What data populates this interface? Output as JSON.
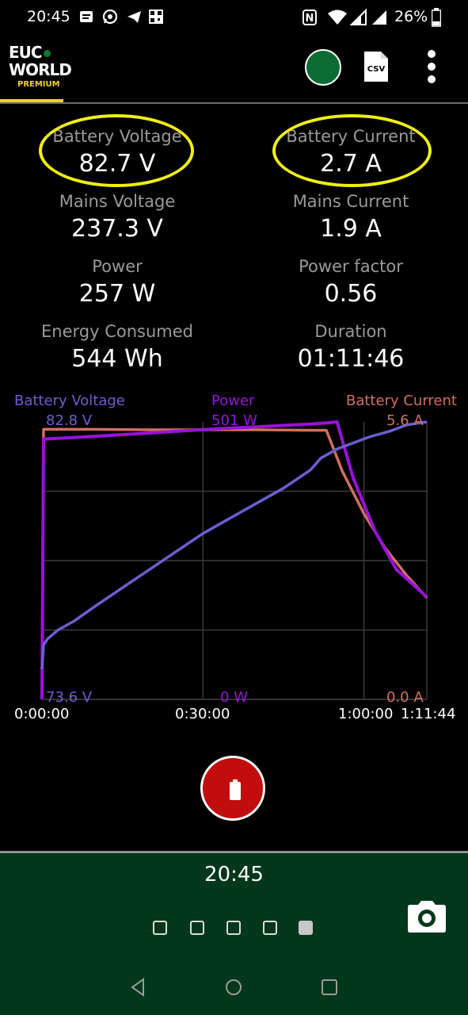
{
  "status_bar": {
    "time": "20:45",
    "battery_pct": "26%",
    "icons_left": [
      "notes-icon",
      "whatsapp-icon",
      "telegram-icon",
      "qr-icon"
    ],
    "icons_right": [
      "nfc-icon",
      "wifi-icon",
      "signal-icon",
      "signal-icon",
      "battery-icon"
    ]
  },
  "app_bar": {
    "logo_line1": "EUC",
    "logo_line2": "WORLD",
    "logo_sub": "PREMIUM",
    "csv_label": "CSV",
    "connection_color": "#0b6b33"
  },
  "stats": [
    {
      "label": "Battery Voltage",
      "value": "82.7 V",
      "highlighted": true
    },
    {
      "label": "Battery Current",
      "value": "2.7 A",
      "highlighted": true
    },
    {
      "label": "Mains Voltage",
      "value": "237.3 V"
    },
    {
      "label": "Mains Current",
      "value": "1.9 A"
    },
    {
      "label": "Power",
      "value": "257 W"
    },
    {
      "label": "Power factor",
      "value": "0.56"
    },
    {
      "label": "Energy Consumed",
      "value": "544 Wh"
    },
    {
      "label": "Duration",
      "value": "01:11:46"
    }
  ],
  "highlight_color": "#f0ef10",
  "chart_data": {
    "type": "line",
    "x_ticks": [
      "0:00:00",
      "0:30:00",
      "1:00:00",
      "1:11:44"
    ],
    "x_tick_minutes": [
      0,
      30,
      60,
      71.73
    ],
    "xlim_minutes": [
      0,
      71.73
    ],
    "grid": true,
    "series": [
      {
        "name": "Battery Voltage",
        "color": "#6a5fd0",
        "max_label": "82.8 V",
        "min_label": "73.6 V",
        "ylim": [
          73.6,
          82.8
        ],
        "x_minutes": [
          0,
          0.3,
          1,
          3,
          6,
          10,
          15,
          20,
          25,
          30,
          35,
          40,
          45,
          50,
          52,
          55,
          58,
          61,
          65,
          68,
          71.73
        ],
        "values": [
          74.6,
          75.4,
          75.6,
          75.9,
          76.2,
          76.7,
          77.3,
          77.9,
          78.5,
          79.1,
          79.6,
          80.1,
          80.6,
          81.2,
          81.6,
          81.9,
          82.1,
          82.3,
          82.5,
          82.7,
          82.8
        ]
      },
      {
        "name": "Power",
        "color": "#9812d8",
        "max_label": "501 W",
        "min_label": "0 W",
        "ylim": [
          0,
          501
        ],
        "x_minutes": [
          0,
          0.3,
          10,
          20,
          30,
          40,
          50,
          53,
          55,
          58,
          62,
          66,
          71.73
        ],
        "values": [
          0,
          470,
          475,
          481,
          487,
          492,
          497,
          499,
          501,
          400,
          305,
          235,
          185
        ]
      },
      {
        "name": "Battery Current",
        "color": "#d0705e",
        "max_label": "5.6 A",
        "min_label": "0.0 A",
        "ylim": [
          0,
          5.6
        ],
        "x_minutes": [
          0,
          0.3,
          10,
          20,
          30,
          40,
          50,
          53,
          56,
          60,
          64,
          68,
          71.73
        ],
        "values": [
          0,
          5.45,
          5.45,
          5.44,
          5.44,
          5.44,
          5.43,
          5.43,
          4.6,
          3.75,
          3.05,
          2.5,
          2.05
        ]
      }
    ]
  },
  "bottom": {
    "time": "20:45",
    "pages": [
      false,
      false,
      false,
      false,
      true
    ]
  },
  "nav": [
    "back-icon",
    "home-icon",
    "recents-icon"
  ]
}
